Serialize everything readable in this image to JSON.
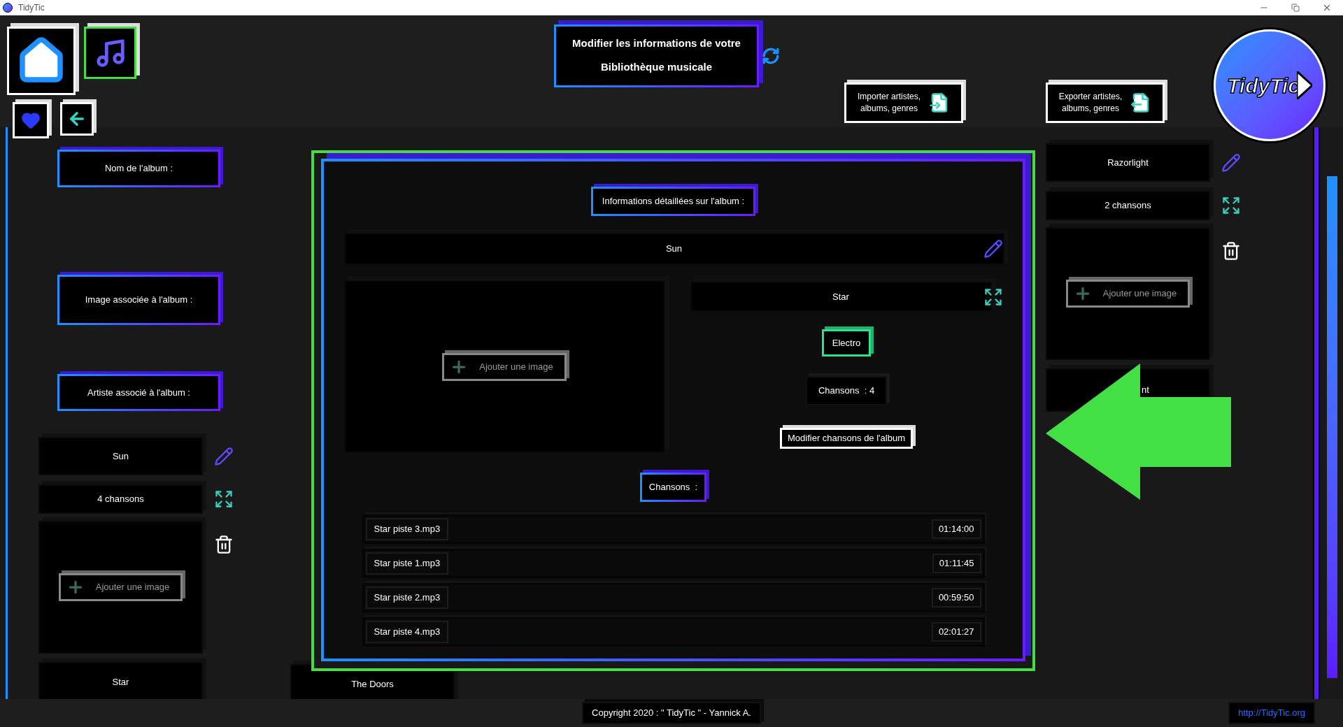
{
  "window": {
    "title": "TidyTic"
  },
  "header": {
    "title_lines": [
      "Modifier les informations de votre",
      "Bibliothèque musicale"
    ],
    "import_button": [
      "Importer artistes,",
      "albums, genres"
    ],
    "export_button": [
      "Exporter artistes,",
      "albums, genres"
    ],
    "logo": "TidyTic"
  },
  "form_labels": [
    "Nom de l'album :",
    "Image associée à l'album :",
    "Artiste associé à l'album :"
  ],
  "left_albums": [
    {
      "kind": "full",
      "name": "Sun",
      "songs": "4 chansons",
      "add_image": "Ajouter une image"
    },
    {
      "kind": "name",
      "name": "Star"
    }
  ],
  "middle_albums": [
    {
      "kind": "name",
      "name": "The Doors"
    }
  ],
  "right_albums": [
    {
      "kind": "full",
      "name": "Razorlight",
      "songs": "2 chansons",
      "add_image": "Ajouter une image"
    },
    {
      "kind": "covered",
      "name": "nt"
    }
  ],
  "modal": {
    "heading": "Informations détaillées sur l'album :",
    "album_name": "Sun",
    "add_image": "Ajouter une image",
    "artist": "Star",
    "genre": "Electro",
    "song_count": "Chansons  : 4",
    "edit_songs_button": "Modifier chansons de l'album",
    "songs_heading": "Chansons  :",
    "songs": [
      {
        "name": "Star piste 3.mp3",
        "duration": "01:14:00"
      },
      {
        "name": "Star piste 1.mp3",
        "duration": "01:11:45"
      },
      {
        "name": "Star piste 2.mp3",
        "duration": "00:59:50"
      },
      {
        "name": "Star piste 4.mp3",
        "duration": "02:01:27"
      }
    ]
  },
  "footer": {
    "copyright": "Copyright 2020 : \" TidyTic \" - Yannick A.",
    "link": "http://TidyTic.org"
  }
}
